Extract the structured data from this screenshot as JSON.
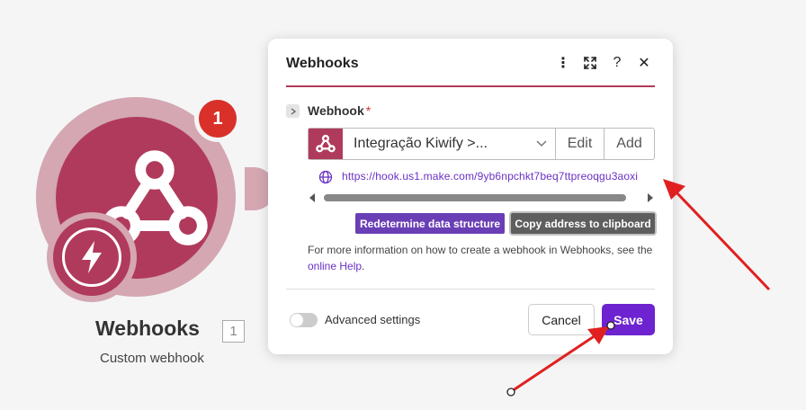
{
  "node": {
    "badge_count": "1",
    "title": "Webhooks",
    "count_label": "1",
    "subtitle": "Custom webhook"
  },
  "dialog": {
    "title": "Webhooks",
    "header_icons": [
      "more-vertical-icon",
      "expand-icon",
      "help-icon",
      "close-icon"
    ],
    "header_glyphs": {
      "more": "⋮",
      "help": "?",
      "close": "✕"
    },
    "field": {
      "label": "Webhook",
      "required_marker": "*",
      "selected_value": "Integração Kiwify >...",
      "edit_label": "Edit",
      "add_label": "Add"
    },
    "url": "https://hook.us1.make.com/9yb6npchkt7beq7ttpreoqgu3aoxi",
    "buttons": {
      "redetermine": "Redetermine data structure",
      "copy": "Copy address to clipboard"
    },
    "help": {
      "text_before": "For more information on how to create a webhook in Webhooks, see the ",
      "link": "online Help",
      "text_after": "."
    },
    "advanced_settings_label": "Advanced settings",
    "advanced_settings_on": false,
    "cancel_label": "Cancel",
    "save_label": "Save"
  },
  "colors": {
    "brand": "#b03a5c",
    "brand_light": "#d4a7b2",
    "badge": "#d9302a",
    "accent_purple": "#6d23d0",
    "annotation_arrow": "#e02020"
  }
}
